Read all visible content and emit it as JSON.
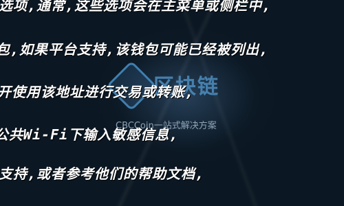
{
  "overlay_lines": [
    "选项,通常,这些选项会在主菜单或侧栏中,",
    "包,如果平台支持,该钱包可能已经被列出,",
    "开使用该地址进行交易或转账,",
    "公共Wi-Fi下输入敏感信息,",
    "支持,或者参考他们的帮助文档,"
  ],
  "logo": {
    "text": "区块链"
  },
  "caption": "CBCCoin一站式解决方案"
}
